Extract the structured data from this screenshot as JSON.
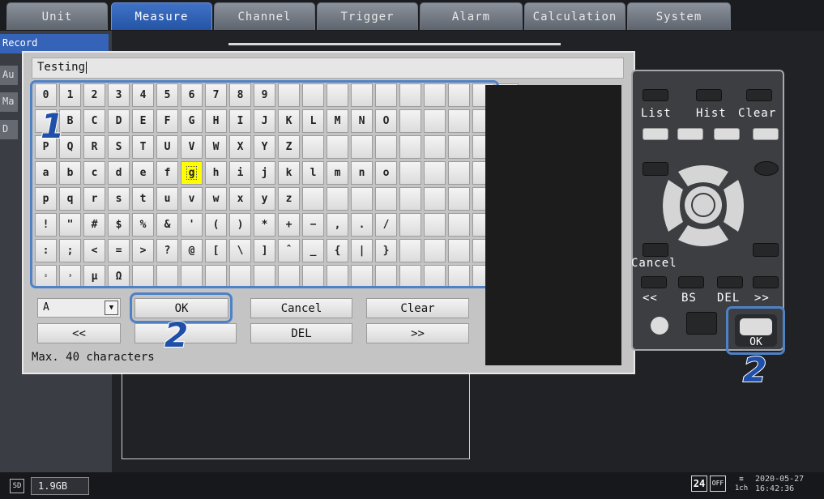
{
  "tabs": [
    {
      "label": "Unit",
      "active": false
    },
    {
      "label": "Measure",
      "active": true
    },
    {
      "label": "Channel",
      "active": false
    },
    {
      "label": "Trigger",
      "active": false
    },
    {
      "label": "Alarm",
      "active": false
    },
    {
      "label": "Calculation",
      "active": false
    },
    {
      "label": "System",
      "active": false
    }
  ],
  "side_menu": [
    {
      "label": "Record"
    },
    {
      "label": "Au"
    },
    {
      "label": "Ma"
    },
    {
      "label": "D"
    }
  ],
  "dialog": {
    "text_value": "Testing",
    "keys": [
      [
        "0",
        "1",
        "2",
        "3",
        "4",
        "5",
        "6",
        "7",
        "8",
        "9",
        "",
        "",
        "",
        "",
        "",
        "",
        "",
        "",
        "",
        ""
      ],
      [
        "",
        "B",
        "C",
        "D",
        "E",
        "F",
        "G",
        "H",
        "I",
        "J",
        "K",
        "L",
        "M",
        "N",
        "O",
        "",
        "",
        "",
        "",
        ""
      ],
      [
        "P",
        "Q",
        "R",
        "S",
        "T",
        "U",
        "V",
        "W",
        "X",
        "Y",
        "Z",
        "",
        "",
        "",
        "",
        "",
        "",
        "",
        "",
        ""
      ],
      [
        "a",
        "b",
        "c",
        "d",
        "e",
        "f",
        "g",
        "h",
        "i",
        "j",
        "k",
        "l",
        "m",
        "n",
        "o",
        "",
        "",
        "",
        "",
        ""
      ],
      [
        "p",
        "q",
        "r",
        "s",
        "t",
        "u",
        "v",
        "w",
        "x",
        "y",
        "z",
        "",
        "",
        "",
        "",
        "",
        "",
        "",
        "",
        ""
      ],
      [
        "!",
        "\"",
        "#",
        "$",
        "%",
        "&",
        "'",
        "(",
        ")",
        "*",
        "+",
        "−",
        ",",
        ".",
        "/",
        "",
        "",
        "",
        "",
        ""
      ],
      [
        ":",
        ";",
        "<",
        "=",
        ">",
        "?",
        "@",
        "[",
        "\\",
        "]",
        "ˆ",
        "_",
        "{",
        "|",
        "}",
        "",
        "",
        "",
        "",
        ""
      ],
      [
        "²",
        "³",
        "µ",
        "Ω",
        "",
        "",
        "",
        "",
        "",
        "",
        "",
        "",
        "",
        "",
        "",
        "",
        "",
        "",
        "",
        ""
      ]
    ],
    "selected_key": "g",
    "charset_select": "A",
    "buttons": {
      "ok": "OK",
      "cancel": "Cancel",
      "clear": "Clear",
      "prev": "<<",
      "del": "DEL",
      "next": ">>"
    },
    "hint": "Max. 40 characters"
  },
  "callouts": {
    "one": "1",
    "two": "2"
  },
  "remote": {
    "list": "List",
    "hist": "Hist",
    "clear": "Clear",
    "cancel": "Cancel",
    "prev": "<<",
    "bs": "BS",
    "del": "DEL",
    "next": ">>",
    "ok": "OK"
  },
  "status": {
    "storage": "1.9GB",
    "sd_label": "SD",
    "rate_badge": "24",
    "off_badge": "OFF",
    "channel": "1ch",
    "date": "2020-05-27",
    "time": "16:42:36"
  },
  "colors": {
    "active_tab": "#2554a4",
    "highlight": "#4f81c7",
    "selected_key": "#ffff00",
    "callout": "#1f4fa8"
  }
}
